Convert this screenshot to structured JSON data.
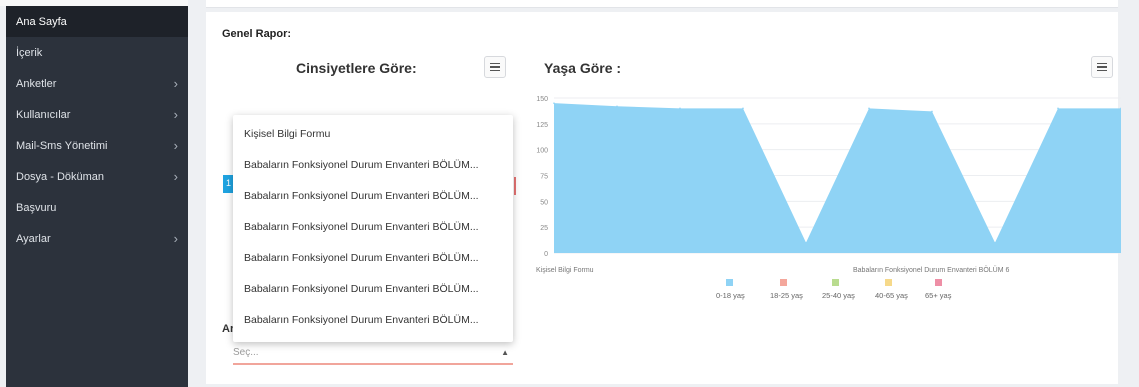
{
  "sidebar": {
    "items": [
      {
        "label": "Ana Sayfa",
        "chevron": false
      },
      {
        "label": "İçerik",
        "chevron": false
      },
      {
        "label": "Anketler",
        "chevron": true
      },
      {
        "label": "Kullanıcılar",
        "chevron": true
      },
      {
        "label": "Mail-Sms Yönetimi",
        "chevron": true
      },
      {
        "label": "Dosya - Döküman",
        "chevron": true
      },
      {
        "label": "Başvuru",
        "chevron": false
      },
      {
        "label": "Ayarlar",
        "chevron": true
      }
    ],
    "chevron_glyph": "›"
  },
  "main": {
    "report_title": "Genel Rapor:",
    "gender_title": "Cinsiyetlere Göre:",
    "age_title": "Yaşa Göre :",
    "blue_tab_text": "1",
    "dropdown_options": [
      "Kişisel Bilgi Formu",
      "Babaların Fonksiyonel Durum Envanteri BÖLÜM...",
      "Babaların Fonksiyonel Durum Envanteri BÖLÜM...",
      "Babaların Fonksiyonel Durum Envanteri BÖLÜM...",
      "Babaların Fonksiyonel Durum Envanteri BÖLÜM...",
      "Babaların Fonksiyonel Durum Envanteri BÖLÜM...",
      "Babaların Fonksiyonel Durum Envanteri BÖLÜM..."
    ],
    "select_label": "Ar",
    "select_placeholder": "Seç...",
    "select_caret": "▲"
  },
  "chart_data": {
    "type": "area",
    "title": "Yaşa Göre :",
    "ylim": [
      0,
      150
    ],
    "yticks": [
      0,
      25,
      50,
      75,
      100,
      125,
      150
    ],
    "x_labels": [
      "Kişisel Bilgi Formu",
      "Babaların Fonksiyonel Durum Envanteri BÖLÜM 6"
    ],
    "series": [
      {
        "name": "0-18 yaş",
        "color": "#8fd3f5",
        "values": [
          145,
          142,
          140,
          140,
          10,
          140,
          137,
          10,
          140,
          140
        ]
      },
      {
        "name": "18-25 yaş",
        "color": "#f4a79c",
        "values": []
      },
      {
        "name": "25-40 yaş",
        "color": "#b9dc8f",
        "values": []
      },
      {
        "name": "40-65 yaş",
        "color": "#f6d98a",
        "values": []
      },
      {
        "name": "65+ yaş",
        "color": "#ee8fa6",
        "values": []
      }
    ],
    "grid": true,
    "legend": "bottom"
  }
}
